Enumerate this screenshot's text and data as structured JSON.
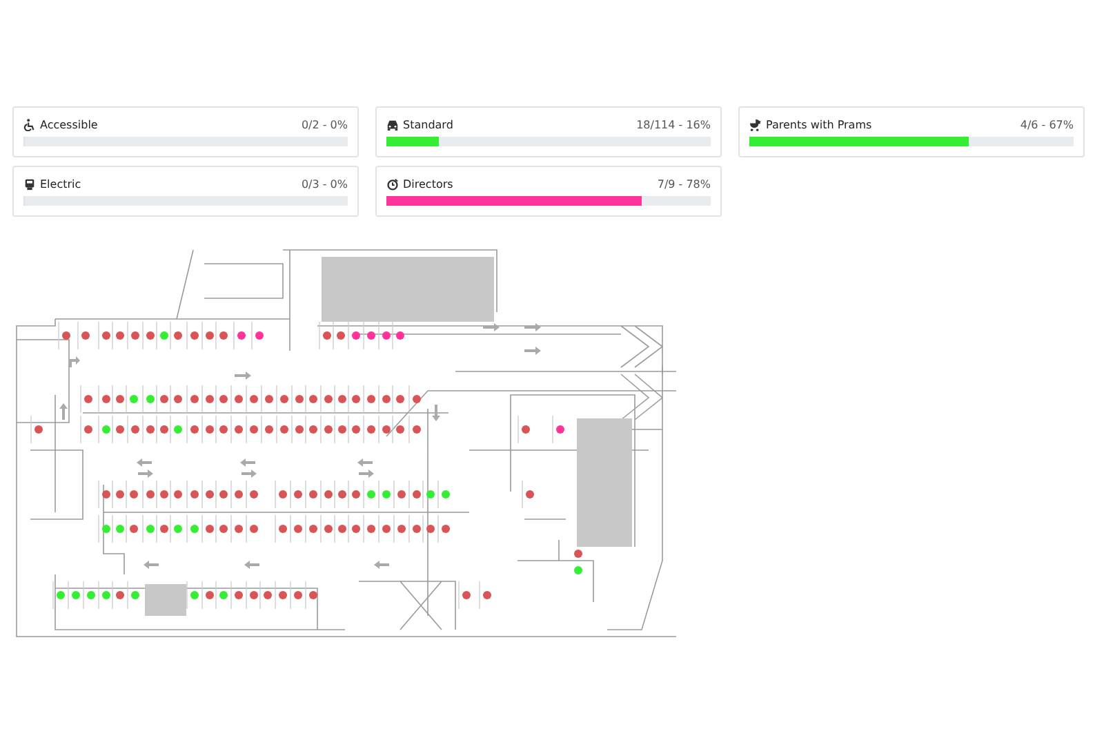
{
  "occupancy_cards": [
    {
      "kind": "accessible",
      "label": "Accessible",
      "count": "0/2 - 0%",
      "level": 0
    },
    {
      "kind": "standard",
      "label": "Standard",
      "count": "18/114 - 16%",
      "level": 0.16,
      "color": "#33ee33"
    },
    {
      "kind": "prams",
      "label": "Parents with Prams",
      "count": "4/6 - 67%",
      "level": 0.67,
      "color": "#33ee33"
    },
    {
      "kind": "electric",
      "label": "Electric",
      "count": "0/3 - 0%",
      "level": 0
    },
    {
      "kind": "directors",
      "label": "Directors",
      "count": "7/9 - 78%",
      "level": 0.78,
      "color": "#ff3399"
    }
  ],
  "floor_plan": {
    "spaces": [
      {
        "color": "#d95555"
      },
      {
        "color": "#d95555"
      },
      {
        "color": "#d95555"
      },
      {
        "color": "#d95555"
      },
      {
        "color": "#d95555"
      },
      {
        "color": "#d95555"
      },
      {
        "color": "#33ee33"
      },
      {
        "color": "#d95555"
      },
      {
        "color": "#d95555"
      },
      {
        "color": "#d95555"
      },
      {
        "color": "#d95555"
      },
      {
        "color": "#ff3399"
      },
      {
        "color": "#ff3399"
      },
      {
        "color": "#d95555"
      },
      {
        "color": "#d95555"
      },
      {
        "color": "#ff3399"
      },
      {
        "color": "#ff3399"
      },
      {
        "color": "#ff3399"
      },
      {
        "color": "#ff3399"
      },
      {
        "color": "#d95555"
      },
      {
        "color": "#d95555"
      },
      {
        "color": "#d95555"
      },
      {
        "color": "#33ee33"
      },
      {
        "color": "#33ee33"
      },
      {
        "color": "#d95555"
      },
      {
        "color": "#d95555"
      },
      {
        "color": "#d95555"
      },
      {
        "color": "#d95555"
      },
      {
        "color": "#d95555"
      },
      {
        "color": "#d95555"
      },
      {
        "color": "#d95555"
      },
      {
        "color": "#d95555"
      },
      {
        "color": "#d95555"
      },
      {
        "color": "#d95555"
      },
      {
        "color": "#d95555"
      },
      {
        "color": "#d95555"
      },
      {
        "color": "#d95555"
      },
      {
        "color": "#d95555"
      },
      {
        "color": "#d95555"
      },
      {
        "color": "#d95555"
      },
      {
        "color": "#d95555"
      },
      {
        "color": "#d95555"
      },
      {
        "color": "#d95555"
      },
      {
        "color": "#d95555"
      },
      {
        "color": "#33ee33"
      },
      {
        "color": "#d95555"
      },
      {
        "color": "#d95555"
      },
      {
        "color": "#d95555"
      },
      {
        "color": "#d95555"
      },
      {
        "color": "#33ee33"
      },
      {
        "color": "#d95555"
      },
      {
        "color": "#d95555"
      },
      {
        "color": "#d95555"
      },
      {
        "color": "#d95555"
      },
      {
        "color": "#d95555"
      },
      {
        "color": "#d95555"
      },
      {
        "color": "#d95555"
      },
      {
        "color": "#d95555"
      },
      {
        "color": "#d95555"
      },
      {
        "color": "#d95555"
      },
      {
        "color": "#d95555"
      },
      {
        "color": "#d95555"
      },
      {
        "color": "#d95555"
      },
      {
        "color": "#d95555"
      },
      {
        "color": "#d95555"
      },
      {
        "color": "#d95555"
      },
      {
        "color": "#d95555"
      },
      {
        "color": "#ff3399"
      },
      {
        "color": "#d95555"
      },
      {
        "color": "#d95555"
      },
      {
        "color": "#d95555"
      },
      {
        "color": "#d95555"
      },
      {
        "color": "#d95555"
      },
      {
        "color": "#d95555"
      },
      {
        "color": "#d95555"
      },
      {
        "color": "#d95555"
      },
      {
        "color": "#d95555"
      },
      {
        "color": "#d95555"
      },
      {
        "color": "#d95555"
      },
      {
        "color": "#d95555"
      },
      {
        "color": "#d95555"
      },
      {
        "color": "#d95555"
      },
      {
        "color": "#d95555"
      },
      {
        "color": "#d95555"
      },
      {
        "color": "#d95555"
      },
      {
        "color": "#33ee33"
      },
      {
        "color": "#33ee33"
      },
      {
        "color": "#d95555"
      },
      {
        "color": "#d95555"
      },
      {
        "color": "#33ee33"
      },
      {
        "color": "#33ee33"
      },
      {
        "color": "#d95555"
      },
      {
        "color": "#33ee33"
      },
      {
        "color": "#33ee33"
      },
      {
        "color": "#d95555"
      },
      {
        "color": "#33ee33"
      },
      {
        "color": "#d95555"
      },
      {
        "color": "#33ee33"
      },
      {
        "color": "#33ee33"
      },
      {
        "color": "#d95555"
      },
      {
        "color": "#d95555"
      },
      {
        "color": "#d95555"
      },
      {
        "color": "#d95555"
      },
      {
        "color": "#d95555"
      },
      {
        "color": "#d95555"
      },
      {
        "color": "#d95555"
      },
      {
        "color": "#d95555"
      },
      {
        "color": "#d95555"
      },
      {
        "color": "#d95555"
      },
      {
        "color": "#d95555"
      },
      {
        "color": "#d95555"
      },
      {
        "color": "#d95555"
      },
      {
        "color": "#d95555"
      },
      {
        "color": "#d95555"
      },
      {
        "color": "#d95555"
      },
      {
        "color": "#33ee33"
      },
      {
        "color": "#33ee33"
      },
      {
        "color": "#33ee33"
      },
      {
        "color": "#33ee33"
      },
      {
        "color": "#d95555"
      },
      {
        "color": "#33ee33"
      },
      {
        "color": "#33ee33"
      },
      {
        "color": "#d95555"
      },
      {
        "color": "#33ee33"
      },
      {
        "color": "#d95555"
      },
      {
        "color": "#d95555"
      },
      {
        "color": "#d95555"
      },
      {
        "color": "#d95555"
      },
      {
        "color": "#d95555"
      },
      {
        "color": "#d95555"
      },
      {
        "color": "#d95555"
      },
      {
        "color": "#d95555"
      },
      {
        "color": "#d95555"
      },
      {
        "color": "#33ee33"
      }
    ]
  }
}
